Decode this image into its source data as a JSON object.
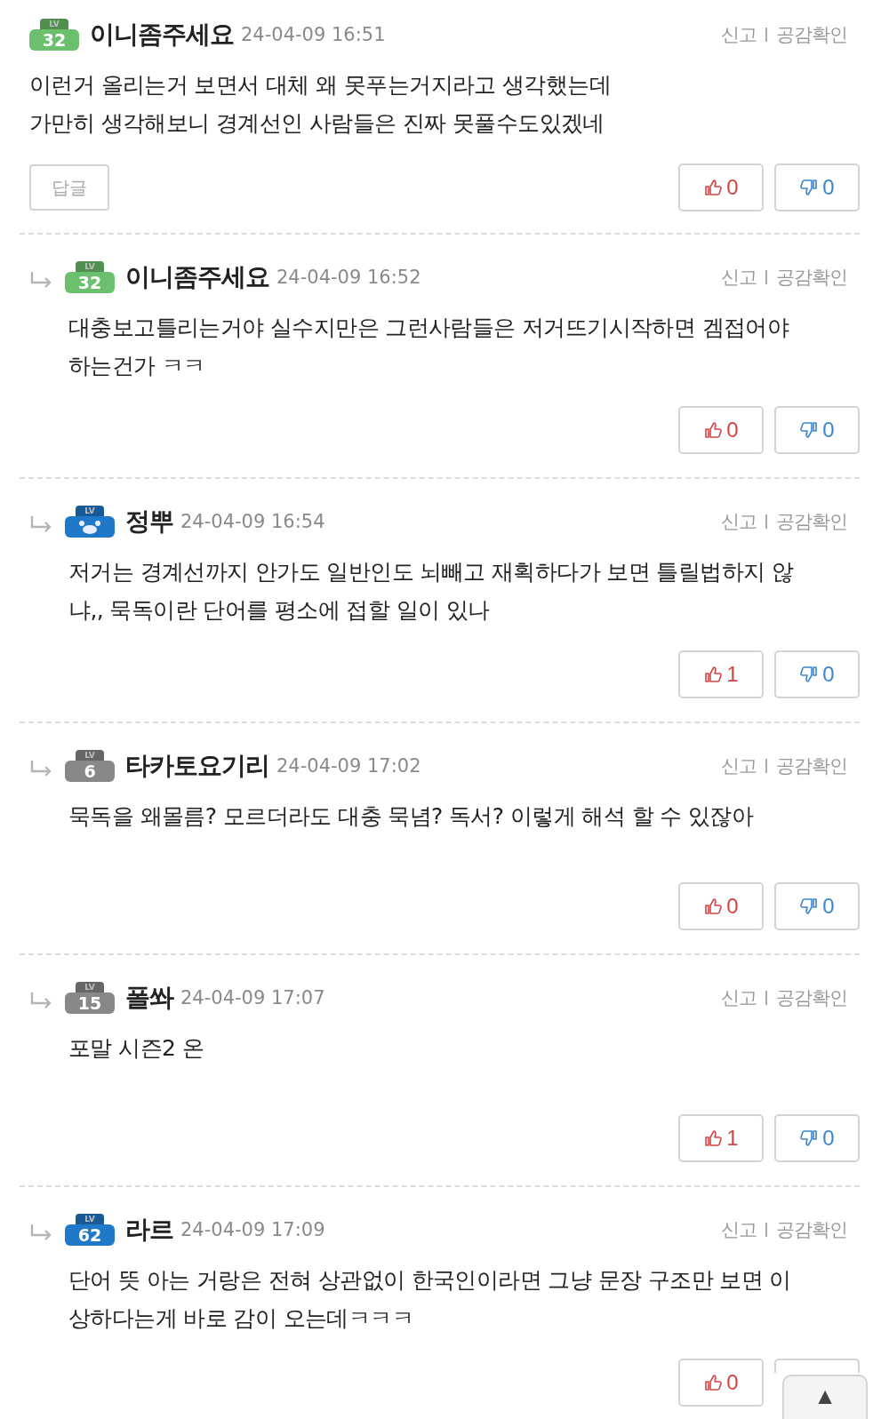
{
  "comments": [
    {
      "kind": "comment",
      "badge": {
        "label": "LV",
        "number": "32",
        "color": "#6cbf6c"
      },
      "author": "이니좀주세요",
      "date": "24-04-09 16:51",
      "actions": [
        "신고",
        "공감확인"
      ],
      "lines": [
        "이런거 올리는거 보면서 대체 왜 못푸는거지라고 생각했는데",
        "가만히 생각해보니 경계선인 사람들은 진짜 못풀수도있겠네"
      ],
      "reply_button": "답글",
      "likes": "0",
      "dislikes": "0"
    },
    {
      "kind": "reply",
      "badge": {
        "label": "LV",
        "number": "32",
        "color": "#6cbf6c"
      },
      "author": "이니좀주세요",
      "date": "24-04-09 16:52",
      "actions": [
        "신고",
        "공감확인"
      ],
      "lines": [
        "대충보고틀리는거야 실수지만은 그런사람들은 저거뜨기시작하면 겜접어야",
        "하는건가 ㅋㅋ"
      ],
      "likes": "0",
      "dislikes": "0"
    },
    {
      "kind": "reply",
      "badge": {
        "label": "LV",
        "color": "#1f78c8"
      },
      "author": "정뿌",
      "date": "24-04-09 16:54",
      "actions": [
        "신고",
        "공감확인"
      ],
      "lines": [
        "저거는 경계선까지 안가도 일반인도 뇌빼고 재획하다가 보면 틀릴법하지 않",
        "냐,, 묵독이란 단어를 평소에 접할 일이 있나"
      ],
      "likes": "1",
      "dislikes": "0"
    },
    {
      "kind": "reply",
      "badge": {
        "label": "LV",
        "number": "6",
        "color": "#888888"
      },
      "author": "타카토요기리",
      "date": "24-04-09 17:02",
      "actions": [
        "신고",
        "공감확인"
      ],
      "lines": [
        "묵독을 왜몰름? 모르더라도 대충 묵념? 독서? 이렇게 해석 할 수 있잖아"
      ],
      "likes": "0",
      "dislikes": "0"
    },
    {
      "kind": "reply",
      "badge": {
        "label": "LV",
        "number": "15",
        "color": "#888888"
      },
      "author": "폴쏴",
      "date": "24-04-09 17:07",
      "actions": [
        "신고",
        "공감확인"
      ],
      "lines": [
        "포말 시즌2 온"
      ],
      "likes": "1",
      "dislikes": "0"
    },
    {
      "kind": "reply",
      "badge": {
        "label": "LV",
        "number": "62",
        "color": "#1f78c8"
      },
      "author": "라르",
      "date": "24-04-09 17:09",
      "actions": [
        "신고",
        "공감확인"
      ],
      "lines": [
        "단어 뜻 아는 거랑은 전혀 상관없이 한국인이라면 그냥 문장 구조만 보면 이",
        "상하다는게 바로 감이 오는데ㅋㅋㅋ"
      ],
      "likes": "0"
    }
  ],
  "scroll_top": "▲"
}
